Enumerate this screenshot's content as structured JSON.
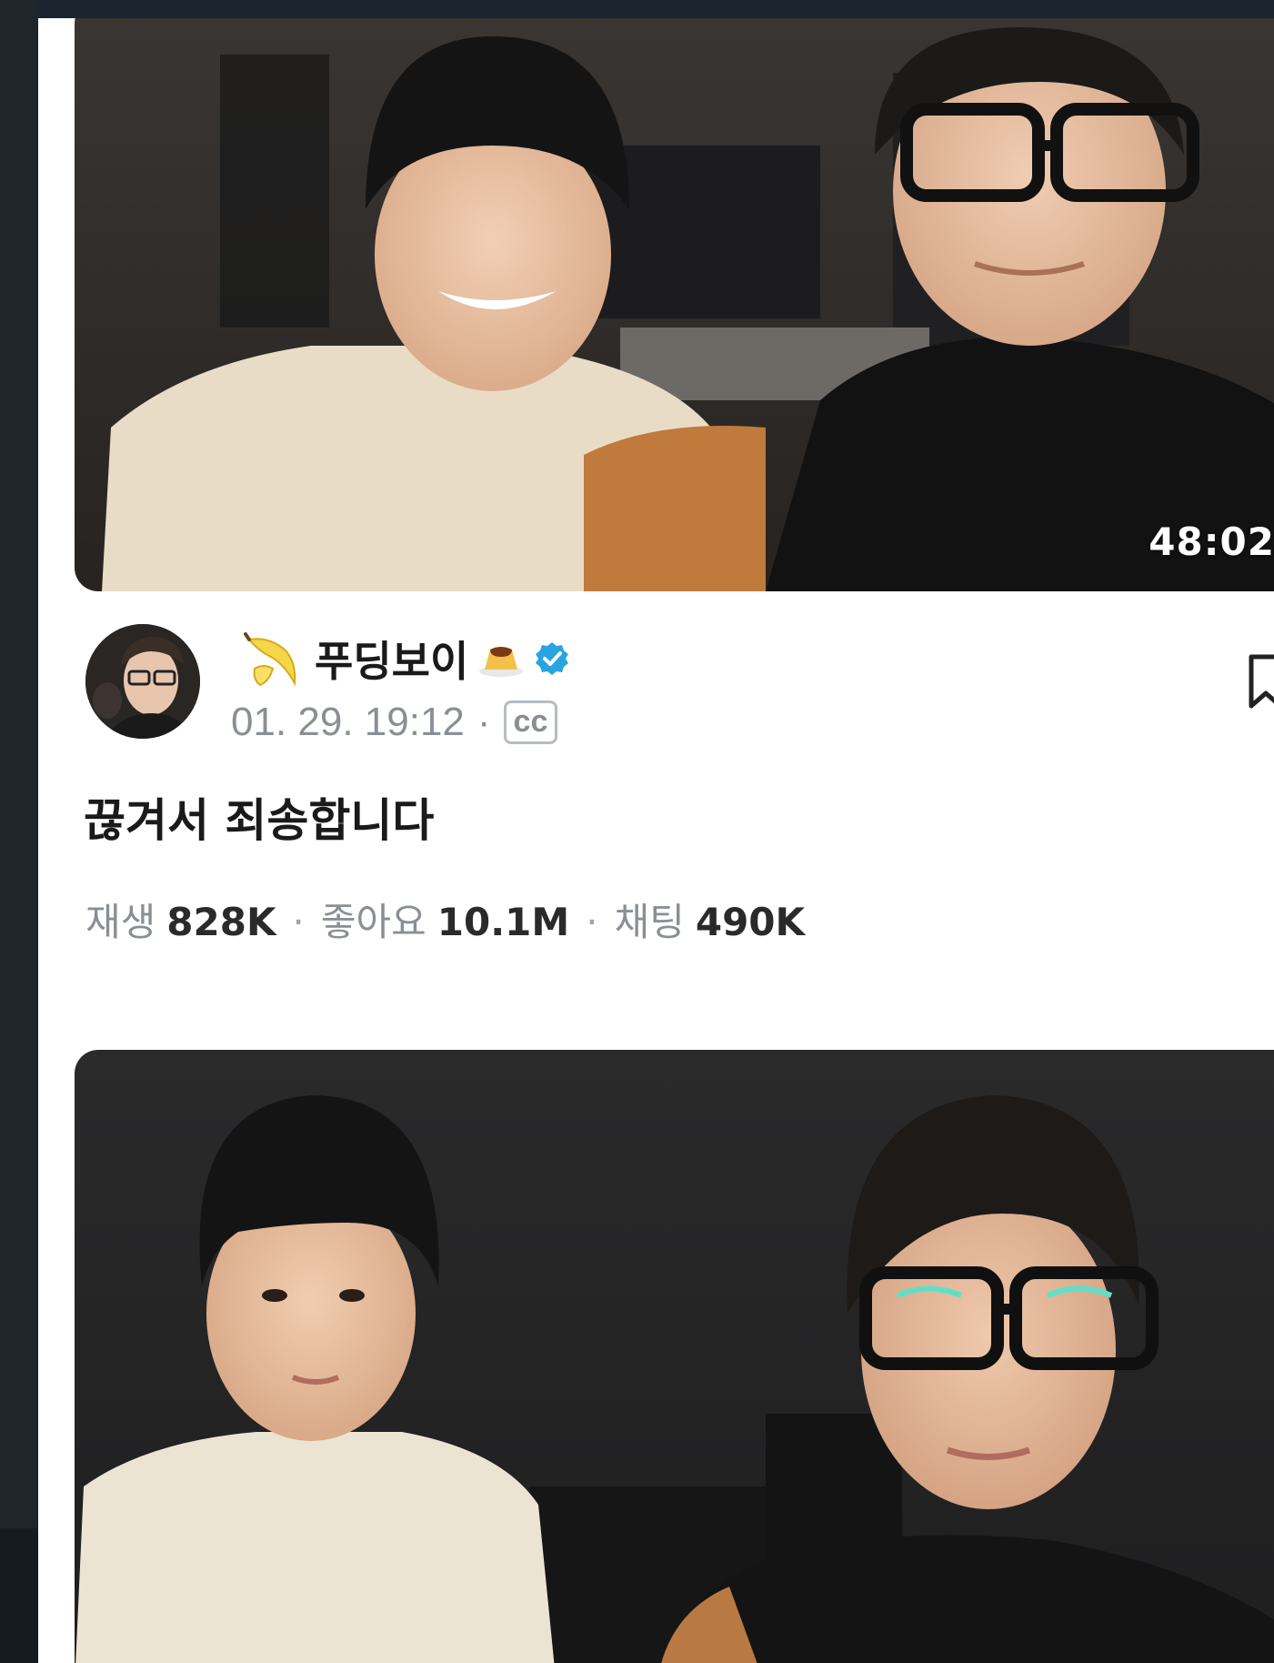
{
  "video_top": {
    "duration": "48:02"
  },
  "channel": {
    "name": "푸딩보이",
    "date": "01. 29. 19:12",
    "separator": "·",
    "cc_label": "cc"
  },
  "video_title": "끊겨서 죄송합니다",
  "stats": {
    "plays_label": "재생",
    "plays_value": "828K",
    "likes_label": "좋아요",
    "likes_value": "10.1M",
    "chats_label": "채팅",
    "chats_value": "490K",
    "separator": "·"
  },
  "icons": {
    "banana": "banana-emoji-icon",
    "pudding": "pudding-emoji-icon",
    "verified": "verified-badge-icon",
    "bookmark": "bookmark-icon"
  },
  "colors": {
    "verified": "#2aa4e0",
    "meta_text": "#8a8f95",
    "title_text": "#1a1a1a"
  }
}
